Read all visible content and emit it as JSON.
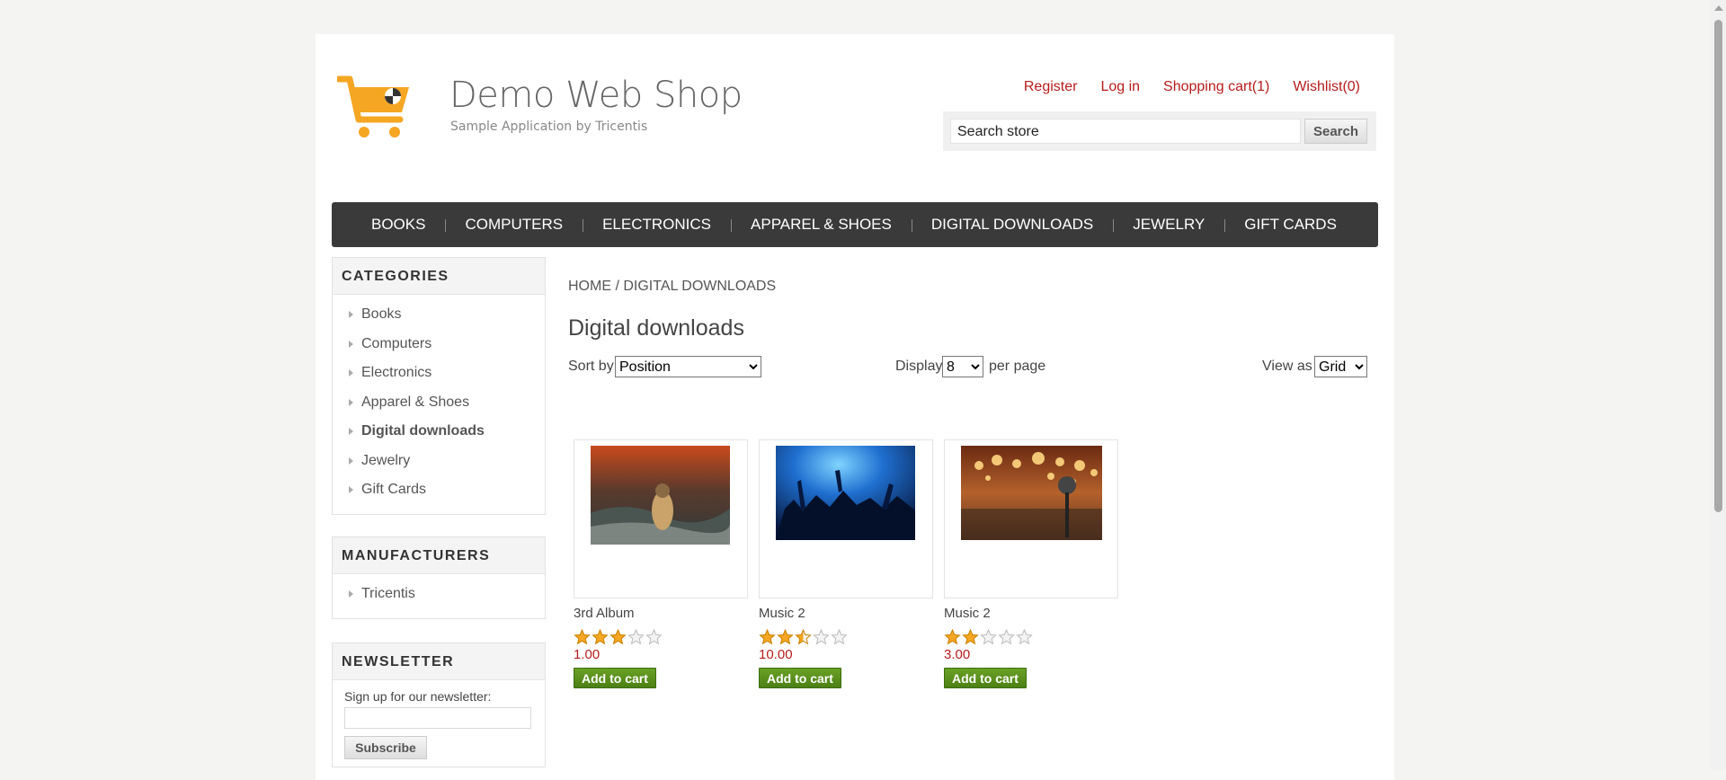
{
  "header": {
    "logo_title": "Demo Web Shop",
    "logo_subtitle": "Sample Application by Tricentis",
    "links": {
      "register": "Register",
      "login": "Log in",
      "cart": "Shopping cart(1)",
      "wishlist": "Wishlist(0)"
    },
    "search": {
      "value": "Search store",
      "button": "Search"
    }
  },
  "topmenu": [
    "BOOKS",
    "COMPUTERS",
    "ELECTRONICS",
    "APPAREL & SHOES",
    "DIGITAL DOWNLOADS",
    "JEWELRY",
    "GIFT CARDS"
  ],
  "sidebar": {
    "categories_title": "CATEGORIES",
    "categories": [
      "Books",
      "Computers",
      "Electronics",
      "Apparel & Shoes",
      "Digital downloads",
      "Jewelry",
      "Gift Cards"
    ],
    "active_category": "Digital downloads",
    "manufacturers_title": "MANUFACTURERS",
    "manufacturers": [
      "Tricentis"
    ],
    "newsletter_title": "NEWSLETTER",
    "newsletter_label": "Sign up for our newsletter:",
    "subscribe": "Subscribe"
  },
  "main": {
    "breadcrumb_home": "HOME",
    "breadcrumb_sep": "/",
    "breadcrumb_current": "DIGITAL DOWNLOADS",
    "title": "Digital downloads",
    "sort_label": "Sort by",
    "sort_value": "Position",
    "display_label": "Display",
    "display_value": "8",
    "per_page": "per page",
    "view_label": "View as",
    "view_value": "Grid"
  },
  "products": [
    {
      "name": "3rd Album",
      "rating": 3,
      "price": "1.00",
      "button": "Add to cart",
      "image": "storm-sea-girl"
    },
    {
      "name": "Music 2",
      "rating": 2.5,
      "price": "10.00",
      "button": "Add to cart",
      "image": "concert-crowd"
    },
    {
      "name": "Music 2",
      "rating": 2,
      "price": "3.00",
      "button": "Add to cart",
      "image": "stage-microphone"
    }
  ],
  "colors": {
    "accent": "#b71c1c",
    "menu_bg": "#3a3a3a",
    "button_green": "#5a9118",
    "star": "#f5a623"
  }
}
